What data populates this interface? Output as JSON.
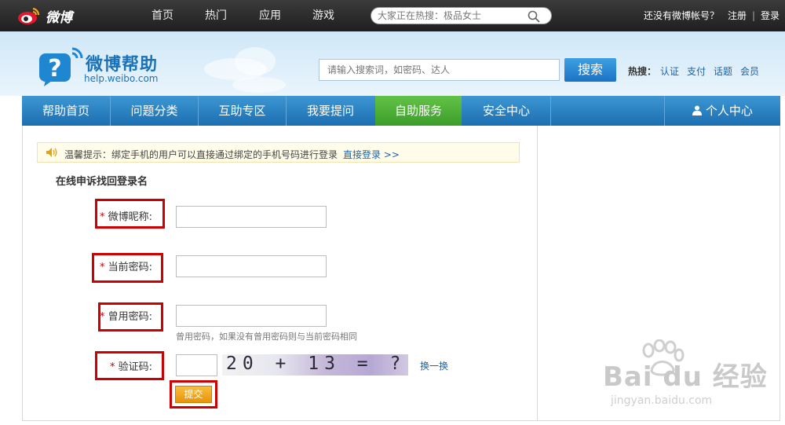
{
  "topbar": {
    "logo_text": "微博",
    "nav": [
      "首页",
      "热门",
      "应用",
      "游戏"
    ],
    "search_placeholder": "大家正在热搜：极品女士",
    "no_account": "还没有微博帐号？",
    "register": "注册",
    "separator": "|",
    "login": "登录"
  },
  "header": {
    "title": "微博帮助",
    "url": "help.weibo.com",
    "search_placeholder": "请输入搜索词，如密码、达人",
    "search_button": "搜索",
    "hot_label": "热搜：",
    "hot_links": [
      "认证",
      "支付",
      "话题",
      "会员"
    ]
  },
  "nav": {
    "items": [
      "帮助首页",
      "问题分类",
      "互助专区",
      "我要提问",
      "自助服务",
      "安全中心"
    ],
    "active": "自助服务",
    "personal": "个人中心"
  },
  "tip": {
    "text": "温馨提示：绑定手机的用户可以直接通过绑定的手机号码进行登录",
    "link": "直接登录 >>"
  },
  "form": {
    "title": "在线申诉找回登录名",
    "required_mark": "*",
    "fields": {
      "nickname": "微博昵称:",
      "current_password": "当前密码:",
      "used_password": "曾用密码:",
      "captcha": "验证码:"
    },
    "used_password_hint": "曾用密码，如果没有曾用密码则与当前密码相同",
    "captcha_text": "20 + 13 = ?",
    "refresh": "换一换",
    "submit": "提交"
  },
  "watermark": {
    "text": "Bai du 经验",
    "url": "jingyan.baidu.com"
  },
  "colors": {
    "nav_blue": "#1c6eb0",
    "nav_active_green": "#3b9d2a",
    "highlight_red": "#cc0000",
    "submit_orange": "#e8940a"
  }
}
